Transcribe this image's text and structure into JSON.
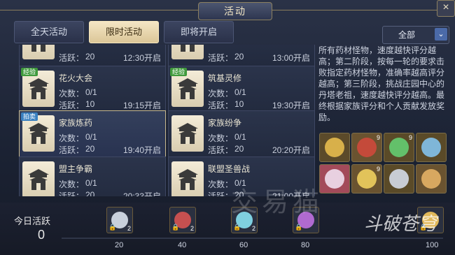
{
  "window": {
    "title": "活动",
    "close": "×"
  },
  "tabs": [
    {
      "label": "全天活动",
      "active": false
    },
    {
      "label": "限时活动",
      "active": true
    },
    {
      "label": "即将开启",
      "active": false
    }
  ],
  "filter": {
    "value": "全部",
    "arrow": "⌄"
  },
  "activities": [
    {
      "name": "",
      "line1_label": "",
      "line1_value": "",
      "line2_label": "活跃：",
      "line2_value": "20",
      "time": "12:30开启",
      "badge": ""
    },
    {
      "name": "",
      "line1_label": "",
      "line1_value": "",
      "line2_label": "活跃：",
      "line2_value": "20",
      "time": "13:00开启",
      "badge": ""
    },
    {
      "name": "花火大会",
      "line1_label": "次数：",
      "line1_value": "0/1",
      "line2_label": "活跃：",
      "line2_value": "10",
      "time": "19:15开启",
      "badge": "经验"
    },
    {
      "name": "筑基灵修",
      "line1_label": "次数：",
      "line1_value": "0/1",
      "line2_label": "活跃：",
      "line2_value": "10",
      "time": "19:30开启",
      "badge": "经验"
    },
    {
      "name": "家族炼药",
      "line1_label": "次数：",
      "line1_value": "0/1",
      "line2_label": "活跃：",
      "line2_value": "20",
      "time": "19:40开启",
      "badge": "拍卖"
    },
    {
      "name": "家族纷争",
      "line1_label": "次数：",
      "line1_value": "0/1",
      "line2_label": "活跃：",
      "line2_value": "20",
      "time": "20:20开启",
      "badge": ""
    },
    {
      "name": "盟主争霸",
      "line1_label": "次数：",
      "line1_value": "0/1",
      "line2_label": "活跃：",
      "line2_value": "20",
      "time": "20:33开启",
      "badge": ""
    },
    {
      "name": "联盟圣兽战",
      "line1_label": "次数：",
      "line1_value": "0/1",
      "line2_label": "活跃：",
      "line2_value": "20",
      "time": "21:00开启",
      "badge": ""
    }
  ],
  "description": {
    "lines": [
      "所有药材怪物，速度越快评分越",
      "高；第二阶段，按每一轮的要求击",
      "败指定药材怪物，准确率越高评分",
      "越高；第三阶段，挑战庄园中心的",
      "丹塔老祖，速度越快评分越高。最",
      "终根据家族评分和个人贡献发放奖",
      "励。"
    ]
  },
  "rewards": [
    {
      "icon": "gold-ring-icon",
      "color": "#d8b04a",
      "bg": "#5b4a2a",
      "count": ""
    },
    {
      "icon": "red-blade-icon",
      "color": "#c44a3a",
      "bg": "#6a5330",
      "count": "9"
    },
    {
      "icon": "green-spirit-icon",
      "color": "#63c06a",
      "bg": "#5a4a28",
      "count": "9"
    },
    {
      "icon": "blue-beast-icon",
      "color": "#7fb6d8",
      "bg": "#5a4a28",
      "count": ""
    },
    {
      "icon": "pearl-box-icon",
      "color": "#e8d0e0",
      "bg": "#a34a5a",
      "count": ""
    },
    {
      "icon": "golden-talisman-icon",
      "color": "#e2c35a",
      "bg": "#6a5330",
      "count": "9"
    },
    {
      "icon": "silver-coin-icon",
      "color": "#c8ccd4",
      "bg": "#5a4a28",
      "count": ""
    },
    {
      "icon": "scroll-icon",
      "color": "#d8a860",
      "bg": "#6a5330",
      "count": ""
    }
  ],
  "today": {
    "label": "今日活跃",
    "value": "0"
  },
  "progress": {
    "fraction": 0.0,
    "milestones": [
      {
        "value": "20",
        "icon": "silver-ring-icon",
        "color": "#c8d0dc",
        "count": "2"
      },
      {
        "value": "40",
        "icon": "red-gem-icon",
        "color": "#c65050",
        "count": "2"
      },
      {
        "value": "60",
        "icon": "blue-crystal-icon",
        "color": "#7fd0e0",
        "count": "2"
      },
      {
        "value": "80",
        "icon": "purple-orb-icon",
        "color": "#b06ad0",
        "count": ""
      },
      {
        "value": "100",
        "icon": "golden-chest-icon",
        "color": "#e0b85a",
        "count": ""
      }
    ]
  },
  "watermark": "交易猫",
  "logo": "斗破苍穹"
}
